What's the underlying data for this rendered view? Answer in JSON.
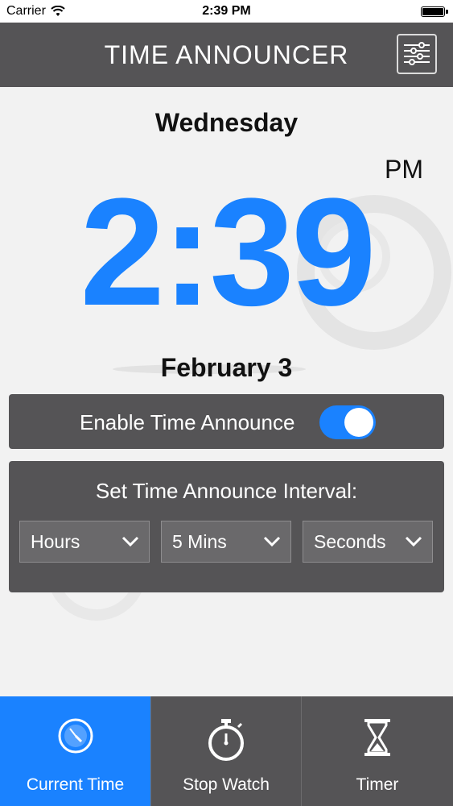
{
  "status_bar": {
    "carrier": "Carrier",
    "time": "2:39 PM"
  },
  "header": {
    "title": "TIME ANNOUNCER",
    "settings_icon": "sliders-icon"
  },
  "clock": {
    "weekday": "Wednesday",
    "ampm": "PM",
    "time": "2:39",
    "date": "February 3"
  },
  "announce": {
    "label": "Enable Time Announce",
    "enabled": true
  },
  "interval": {
    "title": "Set Time Announce Interval:",
    "hours": "Hours",
    "minutes": "5 Mins",
    "seconds": "Seconds"
  },
  "tabs": [
    {
      "label": "Current Time",
      "icon": "clock-icon",
      "active": true
    },
    {
      "label": "Stop Watch",
      "icon": "stopwatch-icon",
      "active": false
    },
    {
      "label": "Timer",
      "icon": "hourglass-icon",
      "active": false
    }
  ],
  "colors": {
    "accent": "#1a82ff",
    "panel": "#555456",
    "background": "#f2f2f2"
  }
}
